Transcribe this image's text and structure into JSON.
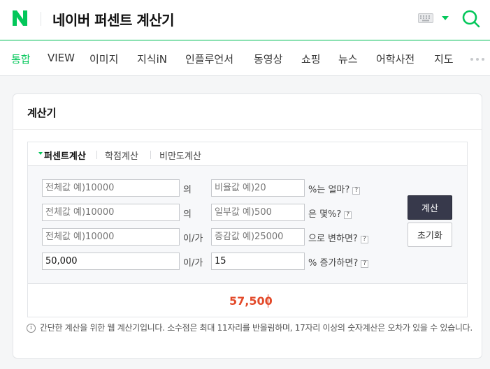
{
  "header": {
    "logo_letter": "N",
    "query": "네이버 퍼센트 계산기"
  },
  "tabs": [
    {
      "label": "통합",
      "active": true
    },
    {
      "label": "VIEW"
    },
    {
      "label": "이미지"
    },
    {
      "label": "지식iN"
    },
    {
      "label": "인플루언서"
    },
    {
      "label": "동영상"
    },
    {
      "label": "쇼핑"
    },
    {
      "label": "뉴스"
    },
    {
      "label": "어학사전"
    },
    {
      "label": "지도"
    }
  ],
  "card": {
    "title": "계산기"
  },
  "calculator": {
    "subtabs": [
      "퍼센트계산",
      "학점계산",
      "비만도계산"
    ],
    "rows": [
      {
        "input1": {
          "value": "",
          "placeholder": "전체값 예)10000"
        },
        "connector": "의",
        "input2": {
          "value": "",
          "placeholder": "비율값 예)20"
        },
        "suffix": "%는 얼마?"
      },
      {
        "input1": {
          "value": "",
          "placeholder": "전체값 예)10000"
        },
        "connector": "의",
        "input2": {
          "value": "",
          "placeholder": "일부값 예)500"
        },
        "suffix": "은 몇%?"
      },
      {
        "input1": {
          "value": "",
          "placeholder": "전체값 예)10000"
        },
        "connector": "이/가",
        "input2": {
          "value": "",
          "placeholder": "증감값 예)25000"
        },
        "suffix": "으로 변하면?"
      },
      {
        "input1": {
          "value": "50,000",
          "placeholder": ""
        },
        "connector": "이/가",
        "input2": {
          "value": "15",
          "placeholder": ""
        },
        "suffix": "% 증가하면?"
      }
    ],
    "help_glyph": "?",
    "calc_button": "계산",
    "reset_button": "초기화",
    "result": "57,500"
  },
  "notice": {
    "icon_glyph": "i",
    "text": "간단한 계산을 위한 웹 계산기입니다. 소수점은 최대 11자리를 반올림하며, 17자리 이상의 숫자계산은 오차가 있을 수 있습니다."
  },
  "colors": {
    "brand_green": "#03c75a",
    "result_red": "#e34a2a",
    "button_dark": "#37394b"
  }
}
